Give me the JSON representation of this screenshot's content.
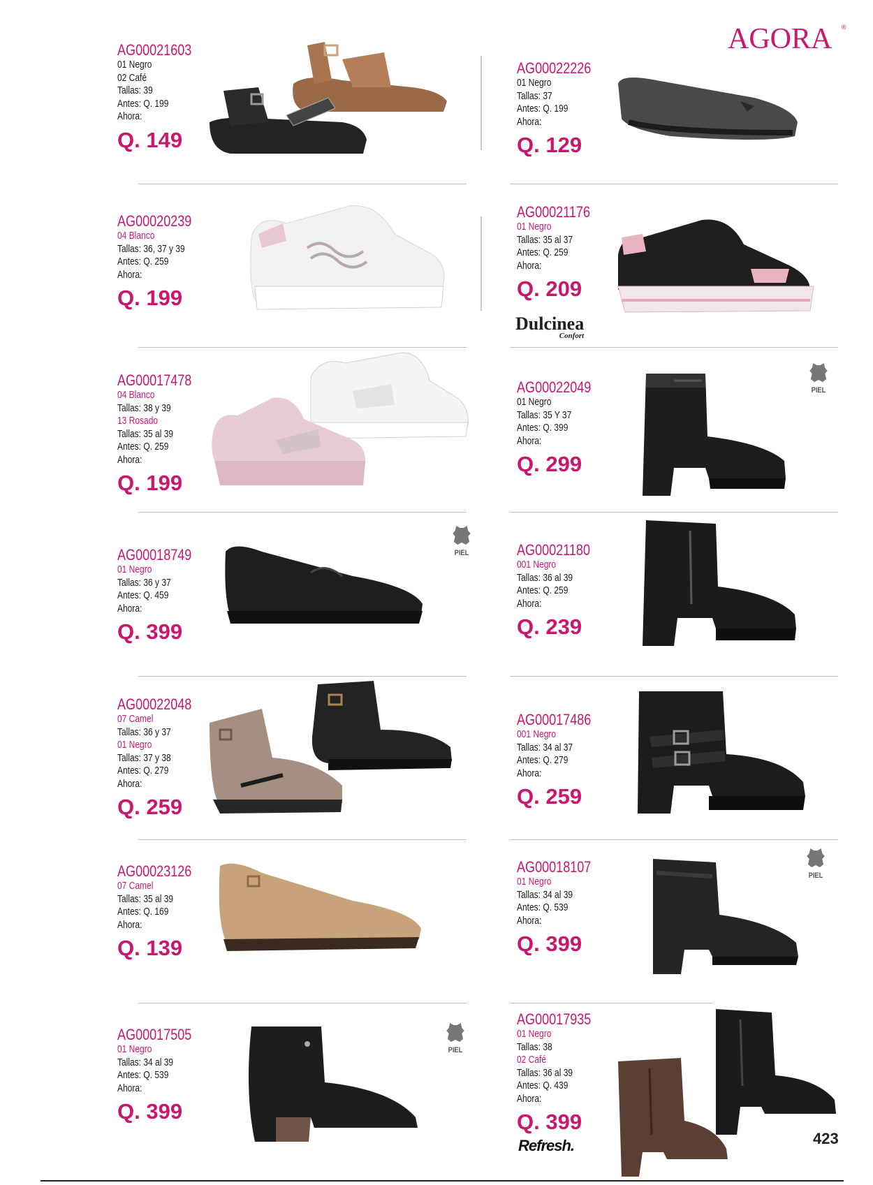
{
  "brand": {
    "name": "AGORA",
    "mark": "®"
  },
  "page_number": "423",
  "logos": {
    "dulcinea": "Dulcinea",
    "dulcinea_sub": "Confort",
    "refresh": "Refresh."
  },
  "piel_label": "PIEL",
  "products": [
    {
      "code": "AG00021603",
      "lines": [
        {
          "text": "01 Negro",
          "tone": "dark"
        },
        {
          "text": "02 Café",
          "tone": "dark"
        },
        {
          "text": "Tallas: 39",
          "tone": "dark"
        },
        {
          "text": "Antes: Q. 199",
          "tone": "dark"
        },
        {
          "text": "Ahora:",
          "tone": "dark"
        }
      ],
      "price": "Q. 149"
    },
    {
      "code": "AG00022226",
      "lines": [
        {
          "text": "01 Negro",
          "tone": "dark"
        },
        {
          "text": "Tallas: 37",
          "tone": "dark"
        },
        {
          "text": "Antes: Q. 199",
          "tone": "dark"
        },
        {
          "text": "Ahora:",
          "tone": "dark"
        }
      ],
      "price": "Q. 129"
    },
    {
      "code": "AG00020239",
      "lines": [
        {
          "text": "04 Blanco",
          "tone": "pink"
        },
        {
          "text": "Tallas: 36, 37 y 39",
          "tone": "dark"
        },
        {
          "text": "Antes: Q. 259",
          "tone": "dark"
        },
        {
          "text": "Ahora:",
          "tone": "dark"
        }
      ],
      "price": "Q. 199"
    },
    {
      "code": "AG00021176",
      "lines": [
        {
          "text": "01 Negro",
          "tone": "pink"
        },
        {
          "text": "Tallas: 35 al 37",
          "tone": "dark"
        },
        {
          "text": "Antes: Q. 259",
          "tone": "dark"
        },
        {
          "text": "Ahora:",
          "tone": "dark"
        }
      ],
      "price": "Q. 209"
    },
    {
      "code": "AG00017478",
      "lines": [
        {
          "text": "04 Blanco",
          "tone": "pink"
        },
        {
          "text": "Tallas: 38 y 39",
          "tone": "dark"
        },
        {
          "text": "13 Rosado",
          "tone": "pink"
        },
        {
          "text": "Tallas: 35 al 39",
          "tone": "dark"
        },
        {
          "text": "Antes: Q. 259",
          "tone": "dark"
        },
        {
          "text": "Ahora:",
          "tone": "dark"
        }
      ],
      "price": "Q. 199"
    },
    {
      "code": "AG00022049",
      "lines": [
        {
          "text": "01 Negro",
          "tone": "dark"
        },
        {
          "text": "Tallas: 35 Y 37",
          "tone": "dark"
        },
        {
          "text": "Antes: Q. 399",
          "tone": "dark"
        },
        {
          "text": "Ahora:",
          "tone": "dark"
        }
      ],
      "price": "Q. 299"
    },
    {
      "code": "AG00018749",
      "lines": [
        {
          "text": "01 Negro",
          "tone": "pink"
        },
        {
          "text": "Tallas: 36 y 37",
          "tone": "dark"
        },
        {
          "text": "Antes: Q. 459",
          "tone": "dark"
        },
        {
          "text": "Ahora:",
          "tone": "dark"
        }
      ],
      "price": "Q. 399"
    },
    {
      "code": "AG00021180",
      "lines": [
        {
          "text": "001 Negro",
          "tone": "pink"
        },
        {
          "text": "Tallas: 36 al 39",
          "tone": "dark"
        },
        {
          "text": "Antes: Q. 259",
          "tone": "dark"
        },
        {
          "text": "Ahora:",
          "tone": "dark"
        }
      ],
      "price": "Q. 239"
    },
    {
      "code": "AG00022048",
      "lines": [
        {
          "text": "07 Camel",
          "tone": "pink"
        },
        {
          "text": "Tallas: 36 y 37",
          "tone": "dark"
        },
        {
          "text": "01 Negro",
          "tone": "pink"
        },
        {
          "text": "Tallas: 37 y 38",
          "tone": "dark"
        },
        {
          "text": "Antes: Q. 279",
          "tone": "dark"
        },
        {
          "text": "Ahora:",
          "tone": "dark"
        }
      ],
      "price": "Q. 259"
    },
    {
      "code": "AG00017486",
      "lines": [
        {
          "text": "001 Negro",
          "tone": "pink"
        },
        {
          "text": "Tallas: 34 al 37",
          "tone": "dark"
        },
        {
          "text": "Antes: Q. 279",
          "tone": "dark"
        },
        {
          "text": "Ahora:",
          "tone": "dark"
        }
      ],
      "price": "Q. 259"
    },
    {
      "code": "AG00023126",
      "lines": [
        {
          "text": "07 Camel",
          "tone": "pink"
        },
        {
          "text": "Tallas: 35 al 39",
          "tone": "dark"
        },
        {
          "text": "Antes: Q. 169",
          "tone": "dark"
        },
        {
          "text": "Ahora:",
          "tone": "dark"
        }
      ],
      "price": "Q. 139"
    },
    {
      "code": "AG00018107",
      "lines": [
        {
          "text": "01 Negro",
          "tone": "pink"
        },
        {
          "text": "Tallas: 34 al 39",
          "tone": "dark"
        },
        {
          "text": "Antes: Q. 539",
          "tone": "dark"
        },
        {
          "text": "Ahora:",
          "tone": "dark"
        }
      ],
      "price": "Q. 399"
    },
    {
      "code": "AG00017505",
      "lines": [
        {
          "text": "01 Negro",
          "tone": "pink"
        },
        {
          "text": "Tallas: 34 al 39",
          "tone": "dark"
        },
        {
          "text": "Antes: Q. 539",
          "tone": "dark"
        },
        {
          "text": "Ahora:",
          "tone": "dark"
        }
      ],
      "price": "Q. 399"
    },
    {
      "code": "AG00017935",
      "lines": [
        {
          "text": "01 Negro",
          "tone": "pink"
        },
        {
          "text": "Tallas: 38",
          "tone": "dark"
        },
        {
          "text": "02 Café",
          "tone": "pink"
        },
        {
          "text": "Tallas: 36 al 39",
          "tone": "dark"
        },
        {
          "text": "Antes: Q. 439",
          "tone": "dark"
        },
        {
          "text": "Ahora:",
          "tone": "dark"
        }
      ],
      "price": "Q. 399"
    }
  ]
}
